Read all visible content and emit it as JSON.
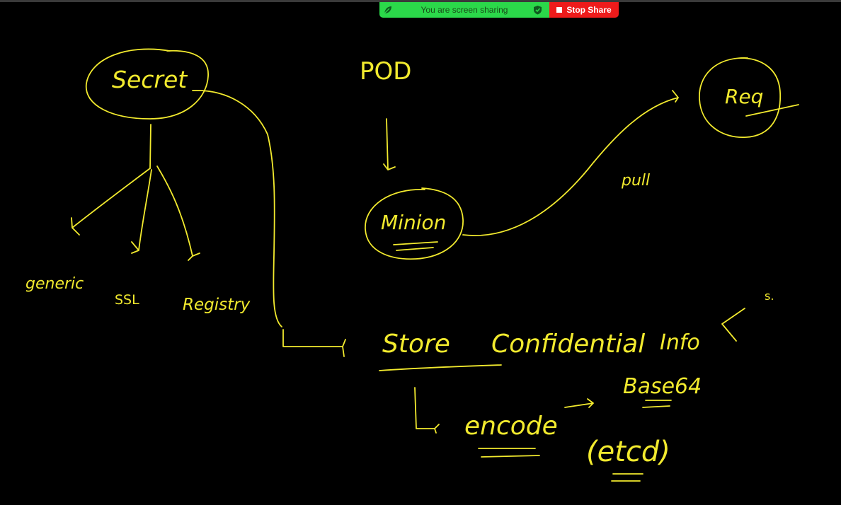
{
  "colors": {
    "background": "#000000",
    "ink": "#f2ea2e",
    "share_green": "#2bd84a",
    "stop_red": "#ee1b1b"
  },
  "share_bar": {
    "status_text": "You are screen sharing",
    "stop_label": "Stop Share",
    "logo_icon": "zoom-leaf-icon",
    "security_icon": "shield-check-icon"
  },
  "whiteboard": {
    "secret": "Secret",
    "generic": "generic",
    "ssl": "SSL",
    "registry": "Registry",
    "pod": "POD",
    "minion": "Minion",
    "pull": "pull",
    "req": "Req",
    "store": "Store",
    "confidential": "Confidential",
    "info": "Info",
    "encode": "encode",
    "base64": "Base64",
    "etcd": "(etcd)",
    "s_note": "s."
  }
}
